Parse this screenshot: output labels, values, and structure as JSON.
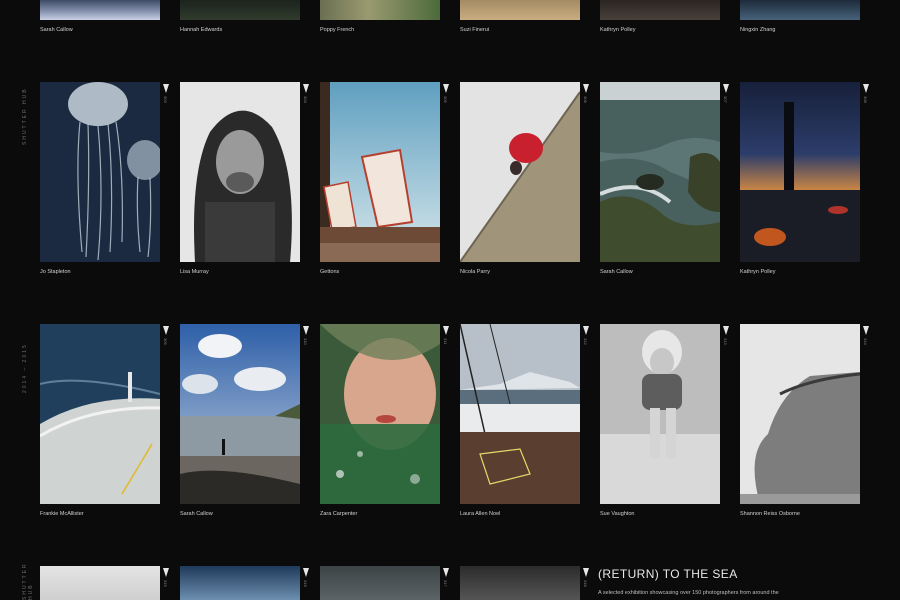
{
  "side_labels": {
    "left_top": "SHUTTER HUB",
    "left_mid": "2014 – 2015",
    "left_bottom": "SHUTTER HUB"
  },
  "row0": {
    "captions": [
      "Sarah Callow",
      "Hannah Edwards",
      "Poppy French",
      "Suzi Finerui",
      "Kathryn Polley",
      "Ningxin Zhang"
    ]
  },
  "row1": {
    "numbers": [
      "303",
      "304",
      "305",
      "306",
      "307",
      "308"
    ],
    "captions": [
      "Jo Stapleton",
      "Lisa Murray",
      "Gettons",
      "Nicola Parry",
      "Sarah Callow",
      "Kathryn Polley"
    ]
  },
  "row2": {
    "numbers": [
      "309",
      "310",
      "311",
      "312",
      "313",
      "314"
    ],
    "captions": [
      "Frankie McAllister",
      "Sarah Callow",
      "Zara Carpenter",
      "Laura Allen Noel",
      "Sue Vaughton",
      "Shannon Reiss Osborne"
    ]
  },
  "row3": {
    "numbers": [
      "315",
      "316",
      "317",
      "318"
    ]
  },
  "exhibition": {
    "title": "(RETURN) TO THE SEA",
    "description": "A selected exhibition showcasing over 150 photographers from around the"
  }
}
